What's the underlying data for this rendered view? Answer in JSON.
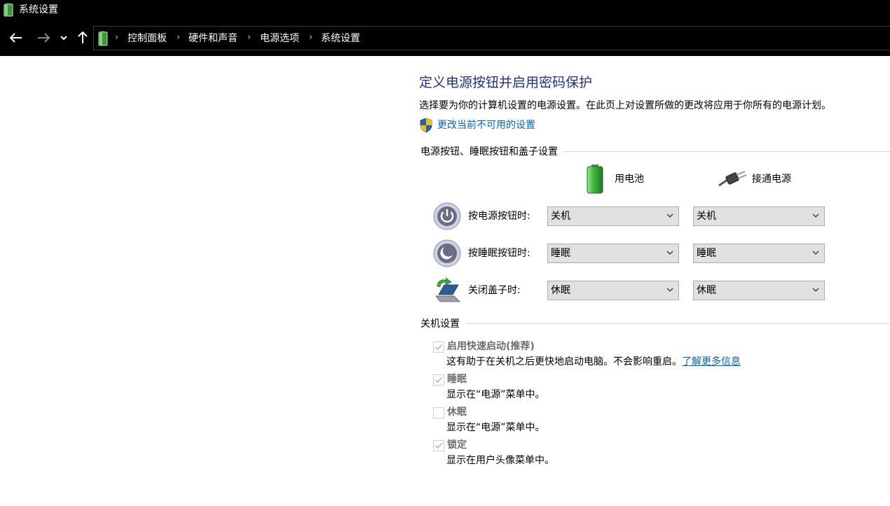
{
  "window": {
    "title": "系统设置",
    "icon": "battery-icon"
  },
  "nav": {
    "back": "back-arrow-icon",
    "forward": "forward-arrow-icon",
    "recent": "chevron-down-icon",
    "up": "up-arrow-icon"
  },
  "breadcrumb": [
    "控制面板",
    "硬件和声音",
    "电源选项",
    "系统设置"
  ],
  "page": {
    "heading": "定义电源按钮并启用密码保护",
    "description": "选择要为你的计算机设置的电源设置。在此页上对设置所做的更改将应用于你所有的电源计划。",
    "change_link": "更改当前不可用的设置"
  },
  "power_buttons": {
    "group_title": "电源按钮、睡眠按钮和盖子设置",
    "col_battery": "用电池",
    "col_plugged": "接通电源",
    "rows": [
      {
        "label": "按电源按钮时:",
        "icon": "power-button-icon",
        "battery": "关机",
        "plugged": "关机"
      },
      {
        "label": "按睡眠按钮时:",
        "icon": "sleep-button-icon",
        "battery": "睡眠",
        "plugged": "睡眠"
      },
      {
        "label": "关闭盖子时:",
        "icon": "laptop-lid-icon",
        "battery": "休眠",
        "plugged": "休眠"
      }
    ]
  },
  "shutdown": {
    "group_title": "关机设置",
    "items": [
      {
        "label": "启用快速启动(推荐)",
        "desc": "这有助于在关机之后更快地启动电脑。不会影响重启。",
        "link": "了解更多信息",
        "checked": true,
        "disabled": true
      },
      {
        "label": "睡眠",
        "desc": "显示在“电源”菜单中。",
        "checked": true,
        "disabled": true
      },
      {
        "label": "休眠",
        "desc": "显示在“电源”菜单中。",
        "checked": false,
        "disabled": true
      },
      {
        "label": "锁定",
        "desc": "显示在用户头像菜单中。",
        "checked": true,
        "disabled": true
      }
    ]
  },
  "colors": {
    "heading": "#1e3287",
    "link": "#0066cc",
    "titlebar": "#000000",
    "disabled_text": "#6d6d6d"
  }
}
